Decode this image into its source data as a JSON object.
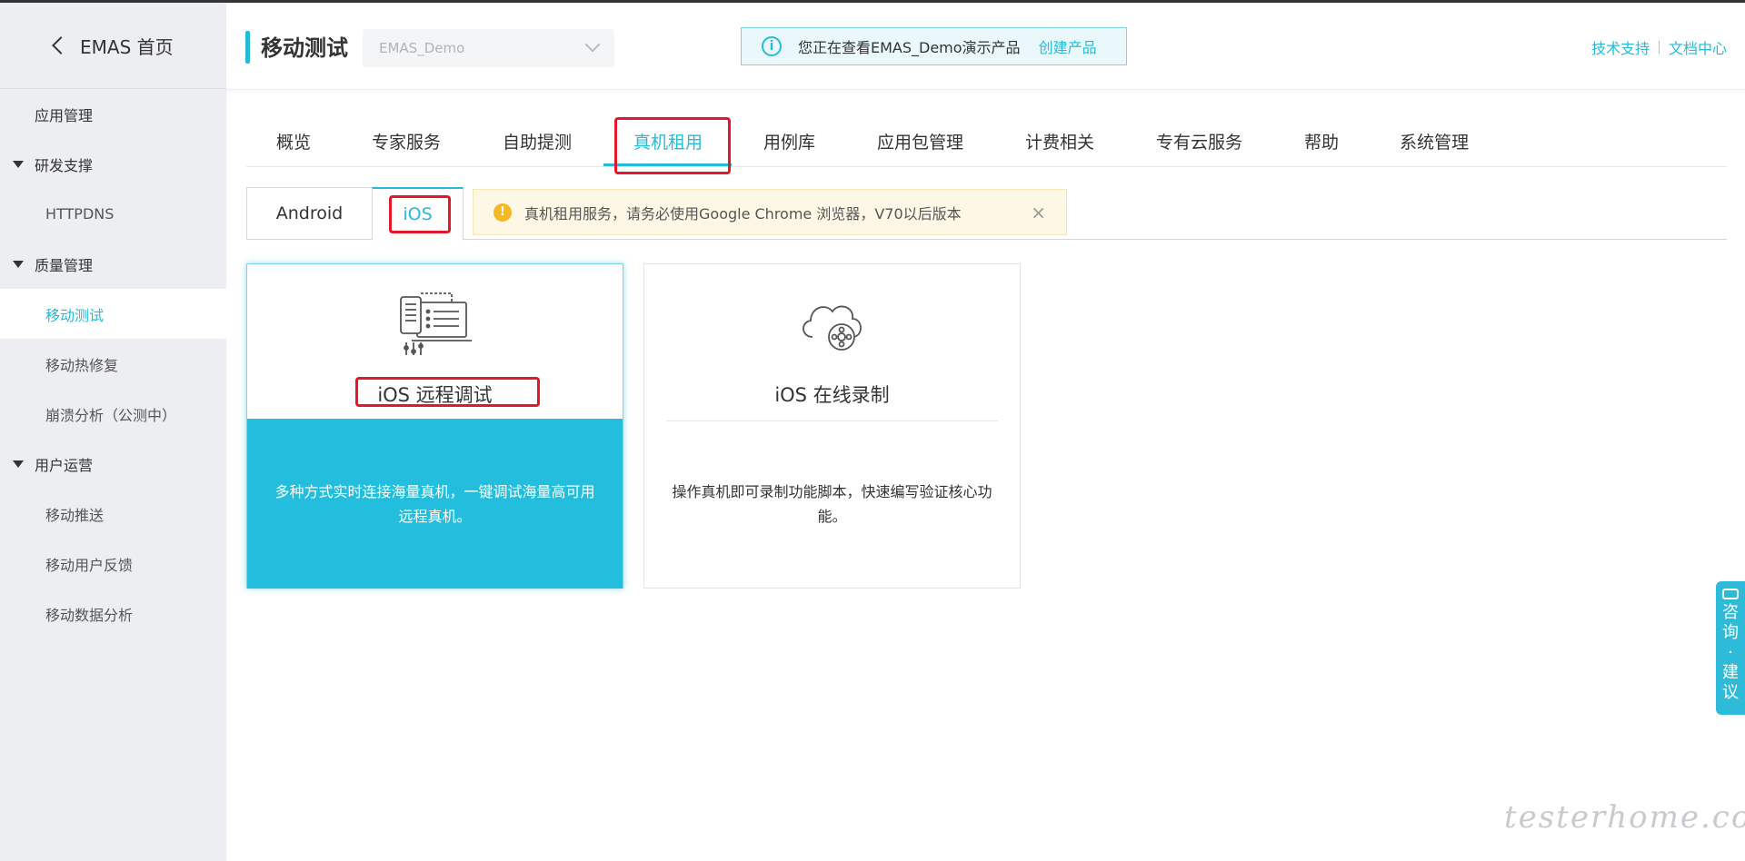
{
  "sidebar": {
    "back_label": "EMAS 首页",
    "items": [
      {
        "label": "应用管理",
        "type": "lvl0"
      },
      {
        "label": "研发支撑",
        "type": "group"
      },
      {
        "label": "HTTPDNS",
        "type": "lvl1"
      },
      {
        "label": "质量管理",
        "type": "group"
      },
      {
        "label": "移动测试",
        "type": "lvl1",
        "active": true
      },
      {
        "label": "移动热修复",
        "type": "lvl1"
      },
      {
        "label": "崩溃分析（公测中）",
        "type": "lvl1"
      },
      {
        "label": "用户运营",
        "type": "group"
      },
      {
        "label": "移动推送",
        "type": "lvl1"
      },
      {
        "label": "移动用户反馈",
        "type": "lvl1"
      },
      {
        "label": "移动数据分析",
        "type": "lvl1"
      }
    ]
  },
  "header": {
    "title": "移动测试",
    "app_select": "EMAS_Demo",
    "notice_text": "您正在查看EMAS_Demo演示产品",
    "notice_link": "创建产品",
    "support_link": "技术支持",
    "docs_link": "文档中心"
  },
  "tabs": [
    "概览",
    "专家服务",
    "自助提测",
    "真机租用",
    "用例库",
    "应用包管理",
    "计费相关",
    "专有云服务",
    "帮助",
    "系统管理"
  ],
  "active_tab": "真机租用",
  "subtabs": {
    "android": "Android",
    "ios": "iOS",
    "warning": "真机租用服务，请务必使用Google Chrome 浏览器，V70以后版本",
    "close": "×"
  },
  "cards": [
    {
      "title": "iOS 远程调试",
      "desc": "多种方式实时连接海量真机，一键调试海量高可用远程真机。",
      "icon": "remote-debug-icon"
    },
    {
      "title": "iOS 在线录制",
      "desc": "操作真机即可录制功能脚本，快速编写验证核心功能。",
      "icon": "cloud-record-icon"
    }
  ],
  "float_button": {
    "chars": [
      "咨",
      "询",
      "·",
      "建",
      "议"
    ]
  },
  "watermark": "testerhome.com",
  "colors": {
    "accent": "#25bbd9",
    "highlight": "#e3182d",
    "warning": "#f5b825"
  }
}
